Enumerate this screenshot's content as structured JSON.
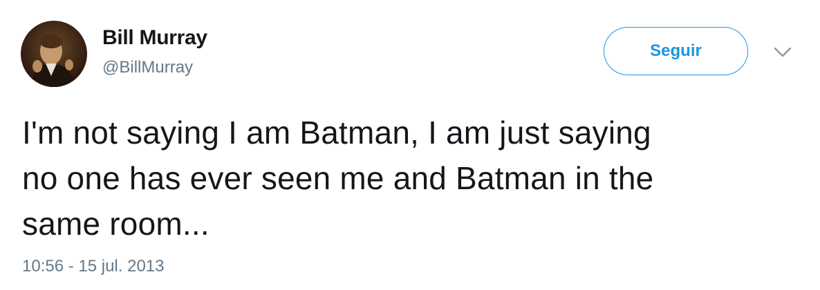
{
  "author": {
    "display_name": "Bill Murray",
    "username": "@BillMurray",
    "avatar": "profile-photo"
  },
  "follow_button": {
    "label": "Seguir",
    "color": "#1b95e0"
  },
  "menu": {
    "icon": "chevron-down-icon"
  },
  "tweet": {
    "text_lines": [
      "I'm not saying I am Batman, I am just saying",
      "no one has ever seen me and Batman in the",
      "same room..."
    ],
    "timestamp": "10:56 - 15 jul. 2013"
  },
  "colors": {
    "text": "#14171a",
    "secondary": "#657786",
    "accent": "#1b95e0"
  }
}
